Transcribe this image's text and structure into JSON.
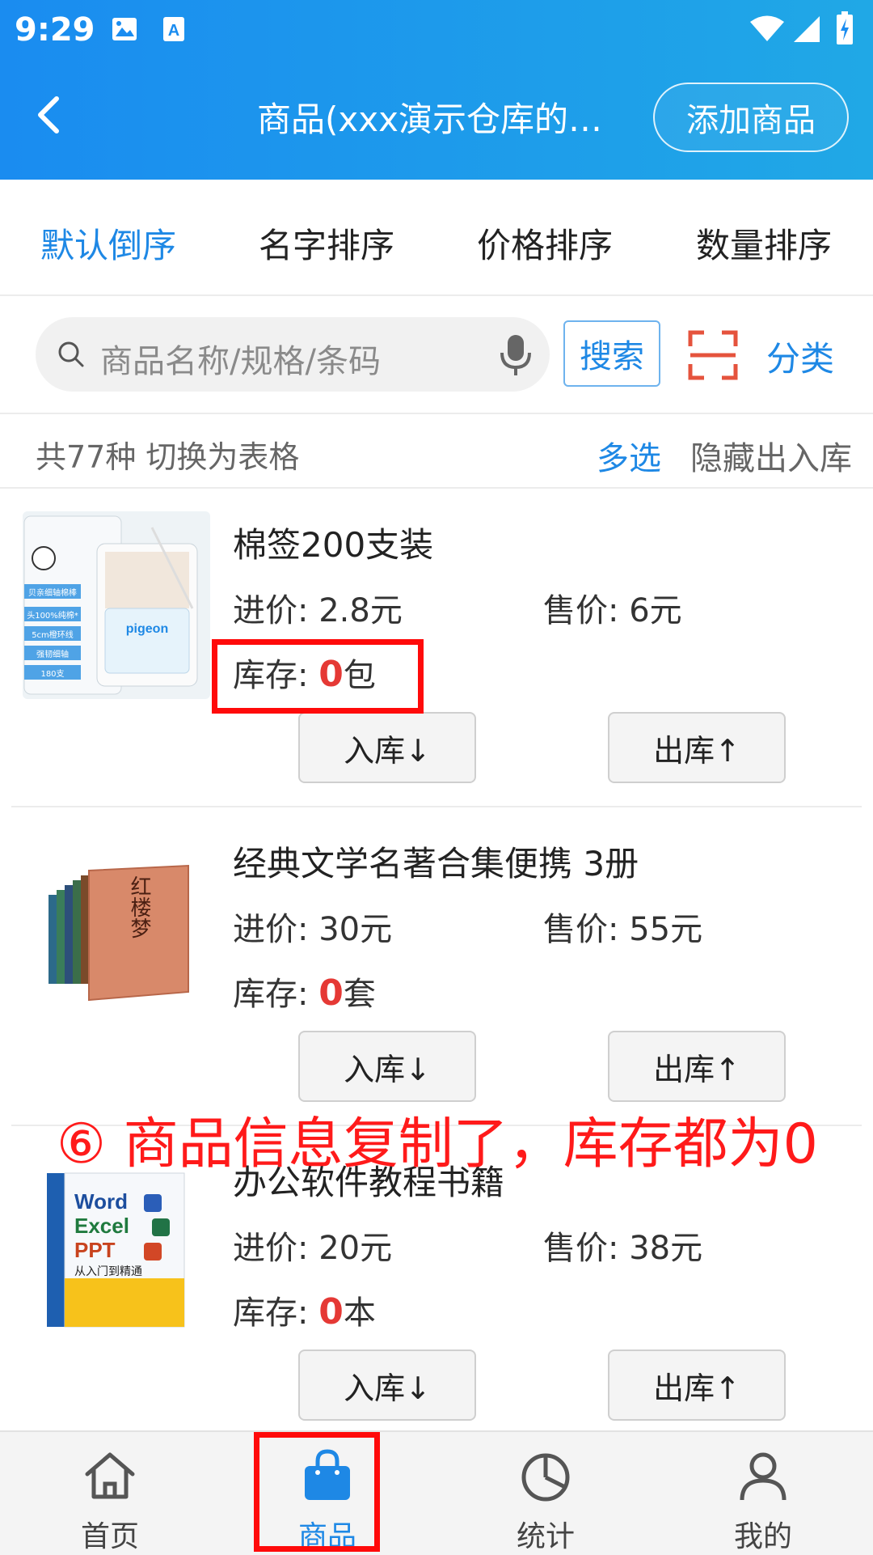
{
  "status": {
    "time": "9:29"
  },
  "header": {
    "title": "商品(xxx演示仓库的…",
    "add_button": "添加商品"
  },
  "sort_tabs": [
    {
      "label": "默认倒序",
      "active": true
    },
    {
      "label": "名字排序",
      "active": false
    },
    {
      "label": "价格排序",
      "active": false
    },
    {
      "label": "数量排序",
      "active": false
    }
  ],
  "search": {
    "placeholder": "商品名称/规格/条码",
    "button": "搜索",
    "category": "分类"
  },
  "summary": {
    "count": "共77种 切换为表格",
    "multi_select": "多选",
    "hide_io": "隐藏出入库"
  },
  "labels": {
    "price_in": "进价:",
    "price_out": "售价:",
    "stock": "库存:",
    "in_button": "入库↓",
    "out_button": "出库↑"
  },
  "products": [
    {
      "name": "棉签200支装",
      "price_in": "2.8元",
      "price_out": "6元",
      "stock_qty": "0",
      "stock_unit": "包",
      "image": "cotton-swab-box"
    },
    {
      "name": "经典文学名著合集便携  3册",
      "price_in": "30元",
      "price_out": "55元",
      "stock_qty": "0",
      "stock_unit": "套",
      "image": "book-set"
    },
    {
      "name": "办公软件教程书籍",
      "price_in": "20元",
      "price_out": "38元",
      "stock_qty": "0",
      "stock_unit": "本",
      "image": "office-book"
    }
  ],
  "thumb_text": {
    "cotton": [
      "贝亲细轴棉棒",
      "头100%纯棉*",
      "5cm橙环线",
      "强韧细轴",
      "180支",
      "pigeon"
    ],
    "book": "红楼梦",
    "office": [
      "Word",
      "Excel",
      "PPT",
      "从入门到精通"
    ]
  },
  "annotation": "⑥ 商品信息复制了，库存都为0",
  "tabbar": [
    {
      "label": "首页",
      "icon": "home-icon",
      "active": false
    },
    {
      "label": "商品",
      "icon": "shopping-bag-icon",
      "active": true
    },
    {
      "label": "统计",
      "icon": "pie-chart-icon",
      "active": false
    },
    {
      "label": "我的",
      "icon": "person-icon",
      "active": false
    }
  ],
  "colors": {
    "header_start": "#1a8cf0",
    "header_end": "#20a8e6",
    "accent": "#1e88e5",
    "zero_stock": "#e53935",
    "annotation": "#ff1a1a",
    "scan": "#e5533d"
  }
}
